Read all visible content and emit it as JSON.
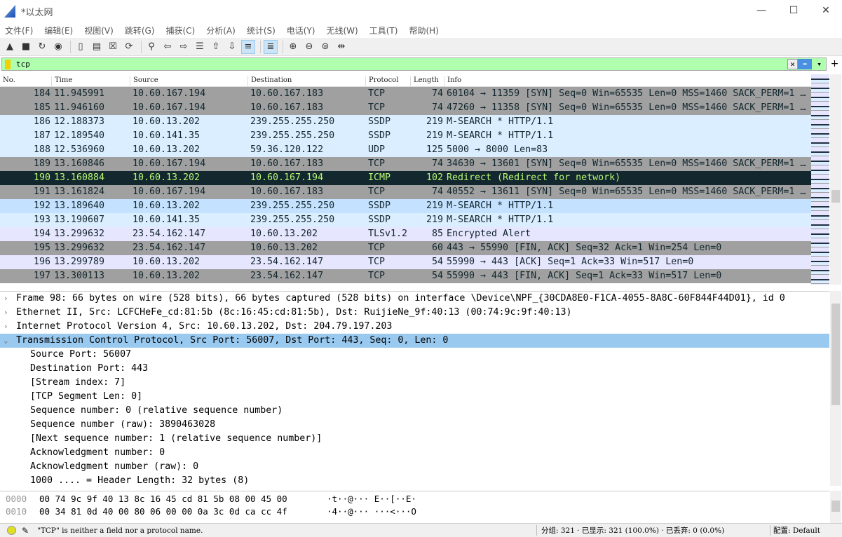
{
  "window": {
    "title": "*以太网",
    "minimize": "—",
    "maximize": "☐",
    "close": "✕"
  },
  "menu": [
    "文件(F)",
    "编辑(E)",
    "视图(V)",
    "跳转(G)",
    "捕获(C)",
    "分析(A)",
    "统计(S)",
    "电话(Y)",
    "无线(W)",
    "工具(T)",
    "帮助(H)"
  ],
  "toolbar": [
    {
      "icon": "shark-fin-start-icon",
      "glyph": "▲"
    },
    {
      "icon": "stop-icon",
      "glyph": "■"
    },
    {
      "icon": "restart-icon",
      "glyph": "↻"
    },
    {
      "icon": "capture-options-icon",
      "glyph": "◉"
    },
    "sep",
    {
      "icon": "open-folder-icon",
      "glyph": "▯"
    },
    {
      "icon": "save-file-icon",
      "glyph": "▤"
    },
    {
      "icon": "close-file-icon",
      "glyph": "☒"
    },
    {
      "icon": "reload-icon",
      "glyph": "⟳"
    },
    "sep",
    {
      "icon": "find-icon",
      "glyph": "⚲"
    },
    {
      "icon": "back-icon",
      "glyph": "⇦"
    },
    {
      "icon": "forward-icon",
      "glyph": "⇨"
    },
    {
      "icon": "go-to-packet-icon",
      "glyph": "☰"
    },
    {
      "icon": "first-packet-icon",
      "glyph": "⇧"
    },
    {
      "icon": "last-packet-icon",
      "glyph": "⇩"
    },
    {
      "icon": "autoscroll-icon",
      "glyph": "≡",
      "on": true
    },
    "sep",
    {
      "icon": "colorize-icon",
      "glyph": "≣",
      "on": true
    },
    "sep",
    {
      "icon": "zoom-in-icon",
      "glyph": "⊕"
    },
    {
      "icon": "zoom-out-icon",
      "glyph": "⊖"
    },
    {
      "icon": "zoom-normal-icon",
      "glyph": "⊜"
    },
    {
      "icon": "resize-columns-icon",
      "glyph": "⇹"
    }
  ],
  "filter": {
    "value": "tcp",
    "clear": "✕",
    "apply": "➡",
    "dropdown": "▾",
    "add": "+"
  },
  "columns": [
    "No.",
    "Time",
    "Source",
    "Destination",
    "Protocol",
    "Length",
    "Info"
  ],
  "packets": [
    {
      "no": "184",
      "time": "11.945991",
      "src": "10.60.167.194",
      "dst": "10.60.167.183",
      "proto": "TCP",
      "len": "74",
      "info": "60104 → 11359 [SYN] Seq=0 Win=65535 Len=0 MSS=1460 SACK_PERM=1 …",
      "bg": "#a0a0a0",
      "fg": "#12272e"
    },
    {
      "no": "185",
      "time": "11.946160",
      "src": "10.60.167.194",
      "dst": "10.60.167.183",
      "proto": "TCP",
      "len": "74",
      "info": "47260 → 11358 [SYN] Seq=0 Win=65535 Len=0 MSS=1460 SACK_PERM=1 …",
      "bg": "#a0a0a0",
      "fg": "#12272e"
    },
    {
      "no": "186",
      "time": "12.188373",
      "src": "10.60.13.202",
      "dst": "239.255.255.250",
      "proto": "SSDP",
      "len": "219",
      "info": "M-SEARCH * HTTP/1.1",
      "bg": "#daeeff",
      "fg": "#12272e"
    },
    {
      "no": "187",
      "time": "12.189540",
      "src": "10.60.141.35",
      "dst": "239.255.255.250",
      "proto": "SSDP",
      "len": "219",
      "info": "M-SEARCH * HTTP/1.1",
      "bg": "#daeeff",
      "fg": "#12272e"
    },
    {
      "no": "188",
      "time": "12.536960",
      "src": "10.60.13.202",
      "dst": "59.36.120.122",
      "proto": "UDP",
      "len": "125",
      "info": "5000 → 8000 Len=83",
      "bg": "#daeeff",
      "fg": "#12272e"
    },
    {
      "no": "189",
      "time": "13.160846",
      "src": "10.60.167.194",
      "dst": "10.60.167.183",
      "proto": "TCP",
      "len": "74",
      "info": "34630 → 13601 [SYN] Seq=0 Win=65535 Len=0 MSS=1460 SACK_PERM=1 …",
      "bg": "#a0a0a0",
      "fg": "#12272e"
    },
    {
      "no": "190",
      "time": "13.160884",
      "src": "10.60.13.202",
      "dst": "10.60.167.194",
      "proto": "ICMP",
      "len": "102",
      "info": "Redirect                    (Redirect for network)",
      "bg": "#12272e",
      "fg": "#b7f774"
    },
    {
      "no": "191",
      "time": "13.161824",
      "src": "10.60.167.194",
      "dst": "10.60.167.183",
      "proto": "TCP",
      "len": "74",
      "info": "40552 → 13611 [SYN] Seq=0 Win=65535 Len=0 MSS=1460 SACK_PERM=1 …",
      "bg": "#a0a0a0",
      "fg": "#12272e"
    },
    {
      "no": "192",
      "time": "13.189640",
      "src": "10.60.13.202",
      "dst": "239.255.255.250",
      "proto": "SSDP",
      "len": "219",
      "info": "M-SEARCH * HTTP/1.1",
      "bg": "#c4e2ff",
      "fg": "#12272e"
    },
    {
      "no": "193",
      "time": "13.190607",
      "src": "10.60.141.35",
      "dst": "239.255.255.250",
      "proto": "SSDP",
      "len": "219",
      "info": "M-SEARCH * HTTP/1.1",
      "bg": "#daeeff",
      "fg": "#12272e"
    },
    {
      "no": "194",
      "time": "13.299632",
      "src": "23.54.162.147",
      "dst": "10.60.13.202",
      "proto": "TLSv1.2",
      "len": "85",
      "info": "Encrypted Alert",
      "bg": "#e7e6ff",
      "fg": "#12272e"
    },
    {
      "no": "195",
      "time": "13.299632",
      "src": "23.54.162.147",
      "dst": "10.60.13.202",
      "proto": "TCP",
      "len": "60",
      "info": "443 → 55990 [FIN, ACK] Seq=32 Ack=1 Win=254 Len=0",
      "bg": "#a0a0a0",
      "fg": "#12272e"
    },
    {
      "no": "196",
      "time": "13.299789",
      "src": "10.60.13.202",
      "dst": "23.54.162.147",
      "proto": "TCP",
      "len": "54",
      "info": "55990 → 443 [ACK] Seq=1 Ack=33 Win=517 Len=0",
      "bg": "#e7e6ff",
      "fg": "#12272e"
    },
    {
      "no": "197",
      "time": "13.300113",
      "src": "10.60.13.202",
      "dst": "23.54.162.147",
      "proto": "TCP",
      "len": "54",
      "info": "55990 → 443 [FIN, ACK] Seq=1 Ack=33 Win=517 Len=0",
      "bg": "#a0a0a0",
      "fg": "#12272e"
    }
  ],
  "details": [
    {
      "text": "Frame 98: 66 bytes on wire (528 bits), 66 bytes captured (528 bits) on interface \\Device\\NPF_{30CDA8E0-F1CA-4055-8A8C-60F844F44D01}, id 0",
      "level": 0,
      "arrow": "›"
    },
    {
      "text": "Ethernet II, Src: LCFCHeFe_cd:81:5b (8c:16:45:cd:81:5b), Dst: RuijieNe_9f:40:13 (00:74:9c:9f:40:13)",
      "level": 0,
      "arrow": "›"
    },
    {
      "text": "Internet Protocol Version 4, Src: 10.60.13.202, Dst: 204.79.197.203",
      "level": 0,
      "arrow": "›"
    },
    {
      "text": "Transmission Control Protocol, Src Port: 56007, Dst Port: 443, Seq: 0, Len: 0",
      "level": 0,
      "arrow": "⌄",
      "selected": true
    },
    {
      "text": "Source Port: 56007",
      "level": 1
    },
    {
      "text": "Destination Port: 443",
      "level": 1
    },
    {
      "text": "[Stream index: 7]",
      "level": 1
    },
    {
      "text": "[TCP Segment Len: 0]",
      "level": 1
    },
    {
      "text": "Sequence number: 0    (relative sequence number)",
      "level": 1
    },
    {
      "text": "Sequence number (raw): 3890463028",
      "level": 1
    },
    {
      "text": "[Next sequence number: 1    (relative sequence number)]",
      "level": 1
    },
    {
      "text": "Acknowledgment number: 0",
      "level": 1
    },
    {
      "text": "Acknowledgment number (raw): 0",
      "level": 1
    },
    {
      "text": "1000 .... = Header Length: 32 bytes (8)",
      "level": 1
    }
  ],
  "hex": [
    {
      "offset": "0000",
      "bytes": "00 74 9c 9f 40 13 8c 16  45 cd 81 5b 08 00 45 00",
      "ascii": "·t··@··· E··[··E·"
    },
    {
      "offset": "0010",
      "bytes": "00 34 81 0d 40 00 80 06  00 00 0a 3c 0d ca cc 4f",
      "ascii": "·4··@··· ···<···O"
    }
  ],
  "status": {
    "message": "\"TCP\" is neither a field nor a protocol name.",
    "packets": "分组: 321 · 已显示: 321 (100.0%) · 已丢弃: 0 (0.0%)",
    "profile": "配置: Default"
  }
}
